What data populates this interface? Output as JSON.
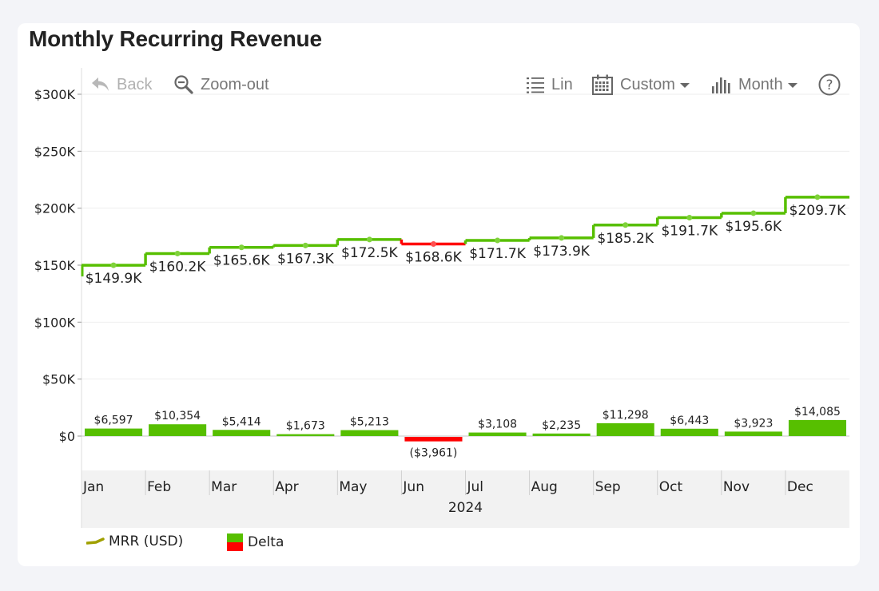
{
  "card": {
    "title": "Monthly Recurring Revenue"
  },
  "toolbar": {
    "back_label": "Back",
    "zoom_out_label": "Zoom-out",
    "scale_label": "Lin",
    "range_label": "Custom",
    "period_label": "Month",
    "help_label": "?"
  },
  "colors": {
    "increase": "#57bf00",
    "decrease": "#ff0000",
    "legend_line": "#a0a000",
    "axis_band": "#f2f2f2",
    "gridline": "#eeeeee"
  },
  "chart_data": {
    "type": "step-line + bar",
    "title": "Monthly Recurring Revenue",
    "xlabel": "2024",
    "ylabel": "",
    "ylim": [
      0,
      300000
    ],
    "yticks": [
      0,
      50000,
      100000,
      150000,
      200000,
      250000,
      300000
    ],
    "ytick_labels": [
      "$0",
      "$50K",
      "$100K",
      "$150K",
      "$200K",
      "$250K",
      "$300K"
    ],
    "categories": [
      "Jan",
      "Feb",
      "Mar",
      "Apr",
      "May",
      "Jun",
      "Jul",
      "Aug",
      "Sep",
      "Oct",
      "Nov",
      "Dec"
    ],
    "year_label": "2024",
    "grid": true,
    "legend_position": "bottom-left",
    "series": [
      {
        "name": "MRR (USD)",
        "type": "step-line",
        "values": [
          149900,
          160200,
          165600,
          167300,
          172500,
          168600,
          171700,
          173900,
          185200,
          191700,
          195600,
          209700
        ],
        "labels": [
          "$149.9K",
          "$160.2K",
          "$165.6K",
          "$167.3K",
          "$172.5K",
          "$168.6K",
          "$171.7K",
          "$173.9K",
          "$185.2K",
          "$191.7K",
          "$195.6K",
          "$209.7K"
        ]
      },
      {
        "name": "Delta",
        "type": "bar",
        "values": [
          6597,
          10354,
          5414,
          1673,
          5213,
          -3961,
          3108,
          2235,
          11298,
          6443,
          3923,
          14085
        ],
        "labels": [
          "$6,597",
          "$10,354",
          "$5,414",
          "$1,673",
          "$5,213",
          "($3,961)",
          "$3,108",
          "$2,235",
          "$11,298",
          "$6,443",
          "$3,923",
          "$14,085"
        ]
      }
    ]
  },
  "legend": [
    {
      "label": "MRR (USD)",
      "icon": "line-swatch"
    },
    {
      "label": "Delta",
      "icon": "two-tone-swatch"
    }
  ]
}
